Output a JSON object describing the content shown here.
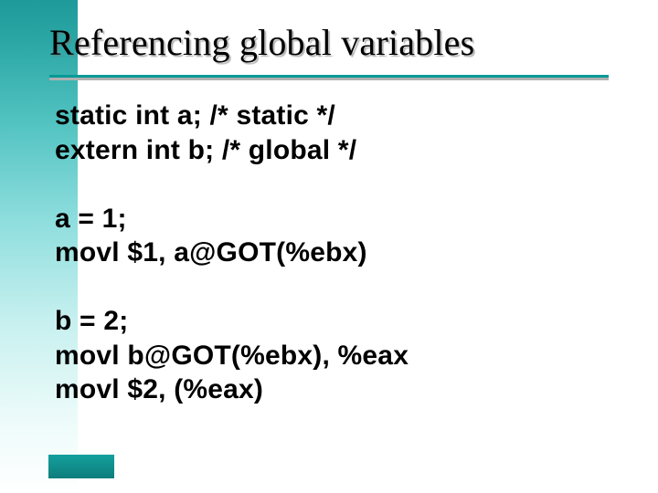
{
  "title": "Referencing global variables",
  "code": {
    "line1": "static int a; /* static */",
    "line2": "extern int b; /* global */",
    "blank1": "",
    "line3": "a = 1;",
    "line4": "movl $1, a@GOT(%ebx)",
    "blank2": "",
    "line5": "b = 2;",
    "line6": "movl b@GOT(%ebx), %eax",
    "line7": "movl $2, (%eax)"
  },
  "colors": {
    "accent": "#009a97",
    "gradient_top": "#1f9a9a"
  }
}
